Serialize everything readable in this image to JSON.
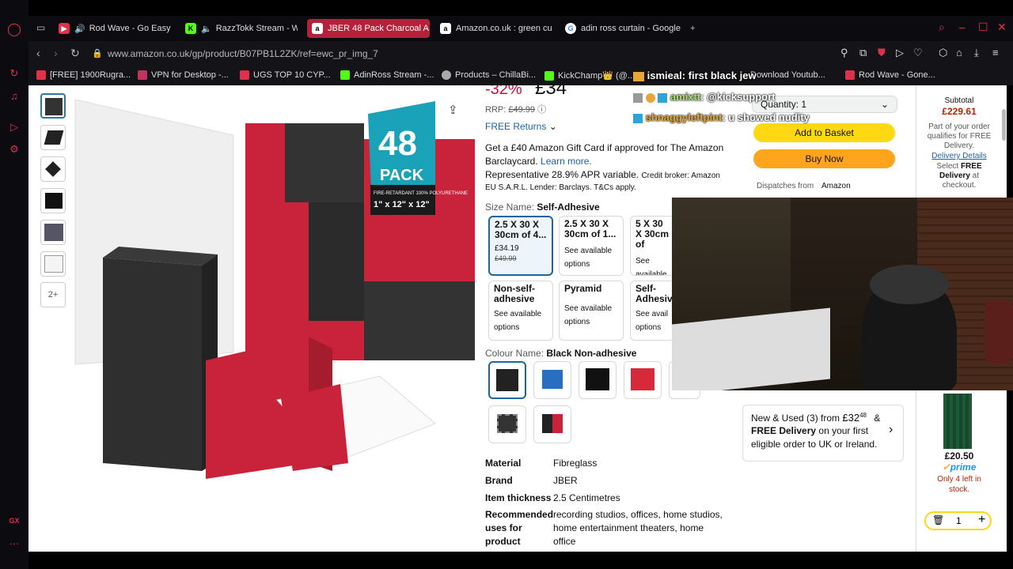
{
  "browser": {
    "tabs": [
      {
        "label": "Rod Wave - Go Easy (",
        "fav_color": "#e0304a",
        "fav_text": "▶"
      },
      {
        "label": "RazzTokk Stream - W",
        "fav_color": "#53fc18",
        "fav_text": "K"
      },
      {
        "label": "JBER 48 Pack Charcoal A",
        "fav_color": "#222",
        "fav_text": "a"
      },
      {
        "label": "Amazon.co.uk : green cu",
        "fav_color": "#222",
        "fav_text": "a"
      },
      {
        "label": "adin ross curtain - Google",
        "fav_color": "#fff",
        "fav_text": "G"
      }
    ],
    "new_tab_label": "+",
    "url": "www.amazon.co.uk/gp/product/B07PB1L2ZK/ref=ewc_pr_img_7",
    "bookmarks": [
      {
        "label": "[FREE] 1900Rugra...",
        "color": "#e0304a"
      },
      {
        "label": "VPN for Desktop -...",
        "color": "#c1345e"
      },
      {
        "label": "UGS TOP 10 CYP...",
        "color": "#e0304a"
      },
      {
        "label": "AdinRoss Stream -...",
        "color": "#53fc18"
      },
      {
        "label": "Products – ChillaBi...",
        "color": "#aaa"
      },
      {
        "label": "KickChamp👑 (@...",
        "color": "#53fc18"
      },
      {
        "label": "Download Youtub...",
        "color": "#e0304a"
      },
      {
        "label": "Rod Wave - Gone...",
        "color": "#e0304a"
      }
    ],
    "accent": "#e0304a"
  },
  "product": {
    "pack_label": "48",
    "pack_word": "PACK",
    "pack_sub": "FIRE-RETARDANT 100% POLYURETHANE",
    "pack_dims": "1\" x 12\" x 12\"",
    "discount": "-32%",
    "price_partial": "£34",
    "rrp_label": "RRP:",
    "rrp_value": "£49.99",
    "free_returns": "FREE Returns",
    "gift_line1": "Get a £40 Amazon Gift Card if approved for The Amazon",
    "gift_line2": "Barclaycard.",
    "learn_more": "Learn more.",
    "apr_text": "Representative 28.9% APR variable.",
    "broker_text": "Credit broker: Amazon",
    "eu_text": "EU S.A.R.L. Lender: Barclays. T&Cs apply.",
    "size_label": "Size Name:",
    "size_value": "Self-Adhesive",
    "size_options": [
      {
        "title": "2.5 X 30 X 30cm of 4...",
        "line1": "£34.19",
        "line2": "£49.99"
      },
      {
        "title": "2.5 X 30 X 30cm of 1...",
        "line1": "See available",
        "line2": "options"
      },
      {
        "title": "5 X 30 X 30cm of",
        "line1": "See available",
        "line2": "options"
      },
      {
        "title": "Non-self-adhesive",
        "line1": "See available",
        "line2": "options"
      },
      {
        "title": "Pyramid",
        "line1": "See available",
        "line2": "options"
      },
      {
        "title": "Self-Adhesive",
        "line1": "See avail",
        "line2": "options"
      }
    ],
    "colour_label": "Colour Name:",
    "colour_value": "Black Non-adhesive",
    "thumbs_more": "2+",
    "details": [
      {
        "k": "Material",
        "v": "Fibreglass"
      },
      {
        "k": "Brand",
        "v": "JBER"
      },
      {
        "k": "Item thickness",
        "v": "2.5 Centimetres"
      }
    ],
    "uses_key1": "Recommended",
    "uses_key2": "uses for",
    "uses_key3": "product",
    "uses_val1": "recording studios, offices, home studios,",
    "uses_val2": "home entertainment theaters, home",
    "uses_val3": "office"
  },
  "buybox": {
    "quantity_label": "Quantity:",
    "quantity_value": "1",
    "add_to_basket": "Add to Basket",
    "buy_now": "Buy Now",
    "dispatches_label": "Dispatches from",
    "dispatches_value": "Amazon",
    "new_used_prefix": "New & Used (3) from ",
    "new_used_price": "£32",
    "new_used_cents": "48",
    "new_used_amp": "&",
    "free_delivery": "FREE Delivery",
    "nu_line2": "on your first",
    "nu_line3": "eligible order to UK or Ireland."
  },
  "cart_panel": {
    "subtotal_label": "Subtotal",
    "subtotal_value": "£229.61",
    "part_line1": "Part of your order",
    "part_line2": "qualifies for FREE",
    "part_line3": "Delivery.",
    "delivery_details": "Delivery Details",
    "select_line1": "Select",
    "select_free": "FREE",
    "select_line2": "Delivery",
    "select_line3": "at",
    "select_line4": "checkout.",
    "item_price": "£20.50",
    "prime_label": "prime",
    "stock_line1": "Only 4 left in",
    "stock_line2": "stock.",
    "qty_value": "1"
  },
  "chat": [
    {
      "user": "ismieal",
      "msg": ": first black jew",
      "user_color": "#ffffff"
    },
    {
      "user": "amixtt",
      "msg": ": @kicksupport",
      "user_color": "#a8e06b"
    },
    {
      "user": "shnaggyleftpint",
      "msg": ": u showed nudity",
      "user_color": "#e8a53a"
    }
  ],
  "side_labels": {
    "gx": "GX",
    "dots": "···"
  }
}
